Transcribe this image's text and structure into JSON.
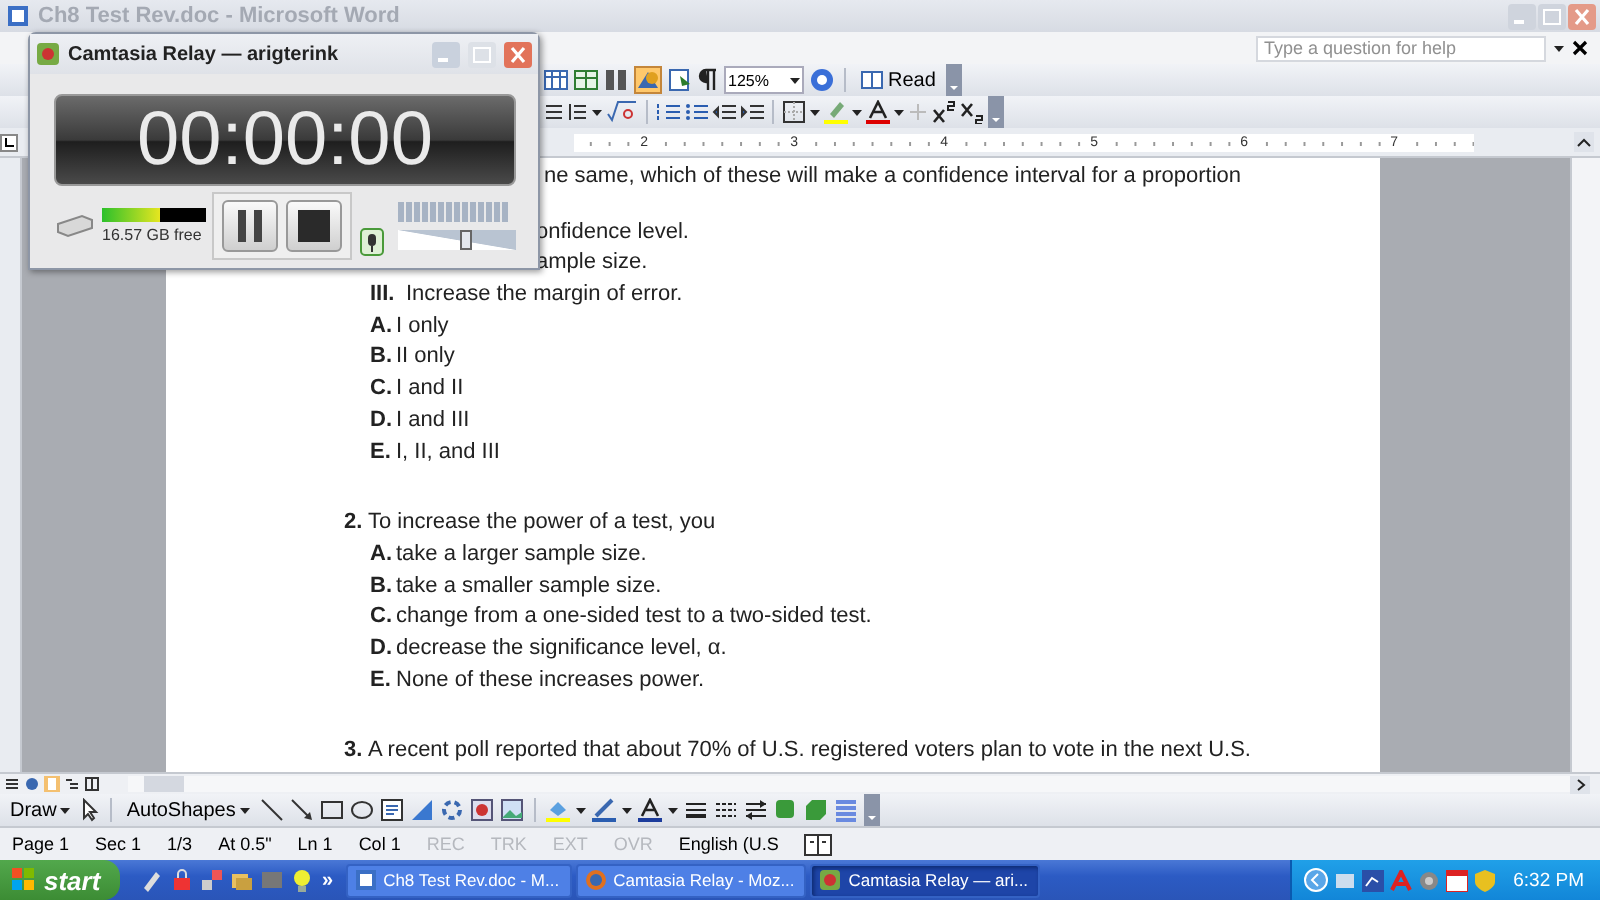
{
  "window": {
    "title": "Ch8 Test Rev.doc - Microsoft Word"
  },
  "help_box": {
    "placeholder": "Type a question for help"
  },
  "standard_toolbar": {
    "zoom": "125%",
    "read_button": "Read"
  },
  "ruler": {
    "labels": [
      "2",
      "3",
      "4",
      "5",
      "6",
      "7"
    ]
  },
  "document": {
    "lines": [
      {
        "kind": "stem",
        "text": "ne same, which of these will make a confidence interval for a proportion"
      },
      {
        "kind": "roman",
        "text": "onfidence level."
      },
      {
        "kind": "roman",
        "text": "ample size."
      },
      {
        "kind": "roman",
        "label": "III.",
        "text": "Increase the margin of error."
      },
      {
        "kind": "option",
        "label": "A.",
        "text": "I only"
      },
      {
        "kind": "option",
        "label": "B.",
        "text": "II only"
      },
      {
        "kind": "option",
        "label": "C.",
        "text": "I and II"
      },
      {
        "kind": "option",
        "label": "D.",
        "text": "I and III"
      },
      {
        "kind": "option",
        "label": "E.",
        "text": "I, II, and III"
      },
      {
        "kind": "stem",
        "label": "2.",
        "text": "To increase the power of a test, you"
      },
      {
        "kind": "option",
        "label": "A.",
        "text": "take a larger sample size."
      },
      {
        "kind": "option",
        "label": "B.",
        "text": "take a smaller sample size."
      },
      {
        "kind": "option",
        "label": "C.",
        "text": "change from a one-sided test to a two-sided test."
      },
      {
        "kind": "option",
        "label": "D.",
        "text": "decrease the significance level, α."
      },
      {
        "kind": "option",
        "label": "E.",
        "text": "None of these increases power."
      },
      {
        "kind": "stem",
        "label": "3.",
        "text": "A recent poll reported that about 70% of U.S. registered voters plan to vote in the next U.S."
      }
    ]
  },
  "drawing_toolbar": {
    "draw_menu": "Draw",
    "autoshapes_menu": "AutoShapes"
  },
  "status_bar": {
    "items": [
      {
        "text": "Page 1",
        "disabled": false
      },
      {
        "text": "Sec 1",
        "disabled": false
      },
      {
        "text": "1/3",
        "disabled": false
      },
      {
        "text": "At 0.5\"",
        "disabled": false
      },
      {
        "text": "Ln 1",
        "disabled": false
      },
      {
        "text": "Col 1",
        "disabled": false
      },
      {
        "text": "REC",
        "disabled": true
      },
      {
        "text": "TRK",
        "disabled": true
      },
      {
        "text": "EXT",
        "disabled": true
      },
      {
        "text": "OVR",
        "disabled": true
      },
      {
        "text": "English (U.S",
        "disabled": false
      }
    ]
  },
  "taskbar": {
    "start": "start",
    "more": "»",
    "tasks": [
      {
        "label": "Ch8 Test Rev.doc - M...",
        "selected": false
      },
      {
        "label": "Camtasia Relay - Moz...",
        "selected": false
      },
      {
        "label": "Camtasia Relay — ari...",
        "selected": true
      }
    ],
    "clock": "6:32 PM"
  },
  "recorder": {
    "title": "Camtasia Relay — arigterink",
    "timer": "00:00:00",
    "disk_free": "16.57 GB free",
    "disk_meter": {
      "level": 0.55
    },
    "volume": {
      "level": 0.58
    }
  }
}
